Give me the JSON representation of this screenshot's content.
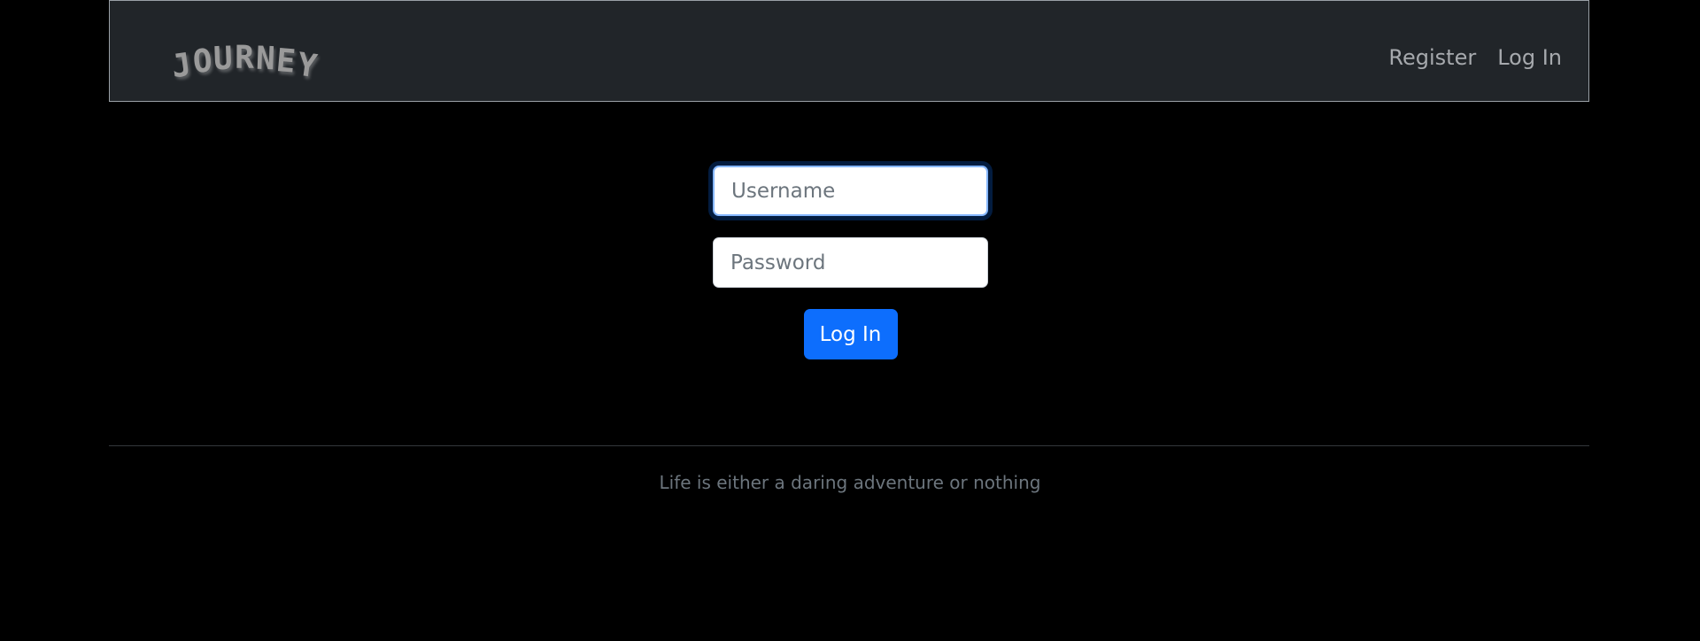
{
  "brand": {
    "logo_text": "JOURNEY"
  },
  "nav": {
    "register_label": "Register",
    "login_label": "Log In"
  },
  "login_form": {
    "username_placeholder": "Username",
    "username_value": "",
    "password_placeholder": "Password",
    "password_value": "",
    "submit_label": "Log In"
  },
  "footer": {
    "tagline": "Life is either a daring adventure or nothing"
  },
  "colors": {
    "page_background": "#000000",
    "navbar_background": "#212529",
    "primary_button": "#0d6efd",
    "muted_text": "#6c757d"
  }
}
